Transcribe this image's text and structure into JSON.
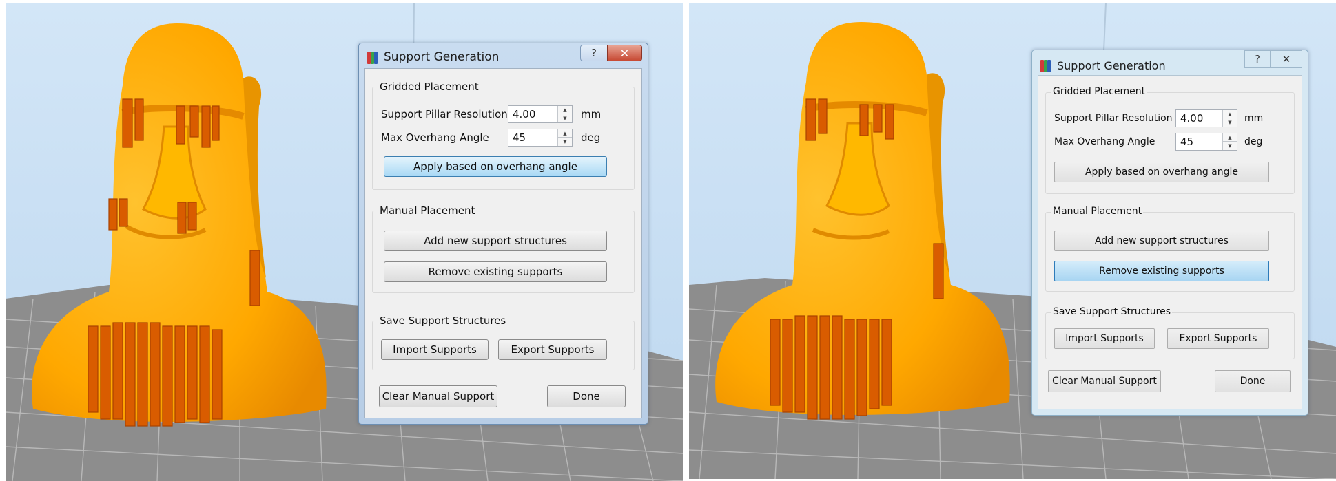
{
  "screens": [
    {
      "dialog": {
        "title": "Support Generation",
        "help_glyph": "?",
        "close_glyph": "✕",
        "gridded": {
          "title": "Gridded Placement",
          "pillar_label": "Support Pillar Resolution",
          "pillar_value": "4.00",
          "pillar_unit": "mm",
          "angle_label": "Max Overhang Angle",
          "angle_value": "45",
          "angle_unit": "deg",
          "apply_label": "Apply based on overhang angle"
        },
        "manual": {
          "title": "Manual Placement",
          "add_label": "Add new support structures",
          "remove_label": "Remove existing supports"
        },
        "save": {
          "title": "Save Support Structures",
          "import_label": "Import Supports",
          "export_label": "Export Supports"
        },
        "clear_label": "Clear Manual Support",
        "done_label": "Done"
      }
    },
    {
      "dialog": {
        "title": "Support Generation",
        "help_glyph": "?",
        "close_glyph": "✕",
        "gridded": {
          "title": "Gridded Placement",
          "pillar_label": "Support Pillar Resolution",
          "pillar_value": "4.00",
          "pillar_unit": "mm",
          "angle_label": "Max Overhang Angle",
          "angle_value": "45",
          "angle_unit": "deg",
          "apply_label": "Apply based on overhang angle"
        },
        "manual": {
          "title": "Manual Placement",
          "add_label": "Add new support structures",
          "remove_label": "Remove existing supports"
        },
        "save": {
          "title": "Save Support Structures",
          "import_label": "Import Supports",
          "export_label": "Export Supports"
        },
        "clear_label": "Clear Manual Support",
        "done_label": "Done"
      }
    }
  ],
  "icons": {
    "app": "support-generation-app-icon",
    "help": "help-icon",
    "close": "close-icon",
    "spin_up": "spin-up-icon",
    "spin_down": "spin-down-icon"
  },
  "colors": {
    "sky": "#cfe3f5",
    "model": "#ffb000",
    "model_shadow": "#e58a00",
    "support": "#d75a00",
    "bed": "#8c8c8c",
    "hover_button": "#a9d9f5"
  }
}
